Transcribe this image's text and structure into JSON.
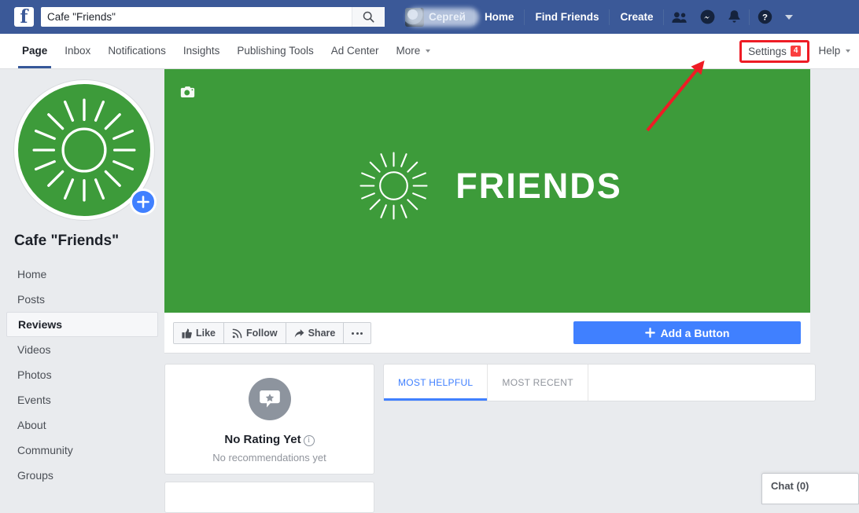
{
  "topbar": {
    "logo": "f",
    "search": {
      "value": "Cafe \"Friends\"",
      "placeholder": "Search",
      "icon": "search-icon"
    },
    "account_name": "Сергей",
    "links": [
      {
        "label": "Home"
      },
      {
        "label": "Find Friends"
      },
      {
        "label": "Create"
      }
    ],
    "icons": [
      {
        "name": "friend-requests-icon"
      },
      {
        "name": "messenger-icon"
      },
      {
        "name": "notifications-bell-icon"
      },
      {
        "name": "help-question-icon"
      },
      {
        "name": "account-dropdown-caret-icon"
      }
    ]
  },
  "tabbar": {
    "tabs": [
      {
        "label": "Page",
        "active": true
      },
      {
        "label": "Inbox",
        "active": false
      },
      {
        "label": "Notifications",
        "active": false
      },
      {
        "label": "Insights",
        "active": false
      },
      {
        "label": "Publishing Tools",
        "active": false
      },
      {
        "label": "Ad Center",
        "active": false
      },
      {
        "label": "More",
        "active": false,
        "dropdown": true
      }
    ],
    "settings": {
      "label": "Settings",
      "badge": "4",
      "highlight_color": "#ee1c25"
    },
    "help": {
      "label": "Help",
      "dropdown": true
    }
  },
  "sidebar": {
    "page_name": "Cafe \"Friends\"",
    "profile_picture": {
      "name": "page-profile-sun-logo",
      "background": "#3d9b3a"
    },
    "add_photo_badge": "+",
    "items": [
      {
        "label": "Home",
        "active": false
      },
      {
        "label": "Posts",
        "active": false
      },
      {
        "label": "Reviews",
        "active": true
      },
      {
        "label": "Videos",
        "active": false
      },
      {
        "label": "Photos",
        "active": false
      },
      {
        "label": "Events",
        "active": false
      },
      {
        "label": "About",
        "active": false
      },
      {
        "label": "Community",
        "active": false
      },
      {
        "label": "Groups",
        "active": false
      }
    ]
  },
  "cover": {
    "background_color": "#3d9b3a",
    "logo_text": "FRIENDS",
    "camera_icon": "camera-icon"
  },
  "actionbar": {
    "buttons": [
      {
        "label": "Like",
        "icon": "thumbs-up-icon"
      },
      {
        "label": "Follow",
        "icon": "rss-follow-icon"
      },
      {
        "label": "Share",
        "icon": "share-arrow-icon"
      },
      {
        "label": "",
        "icon": "ellipsis-icon"
      }
    ],
    "cta": {
      "label": "Add a Button",
      "icon": "plus-icon",
      "color": "#4080ff"
    }
  },
  "rating_card": {
    "icon": "review-star-bubble-icon",
    "title": "No Rating Yet",
    "info_icon": "i",
    "subtitle": "No recommendations yet"
  },
  "reviews_panel": {
    "tabs": [
      {
        "label": "MOST HELPFUL",
        "active": true
      },
      {
        "label": "MOST RECENT",
        "active": false
      }
    ]
  },
  "chat_dock": {
    "label": "Chat (0)"
  },
  "annotation": {
    "type": "red-arrow",
    "color": "#ee1c25",
    "points_to": "Settings"
  }
}
